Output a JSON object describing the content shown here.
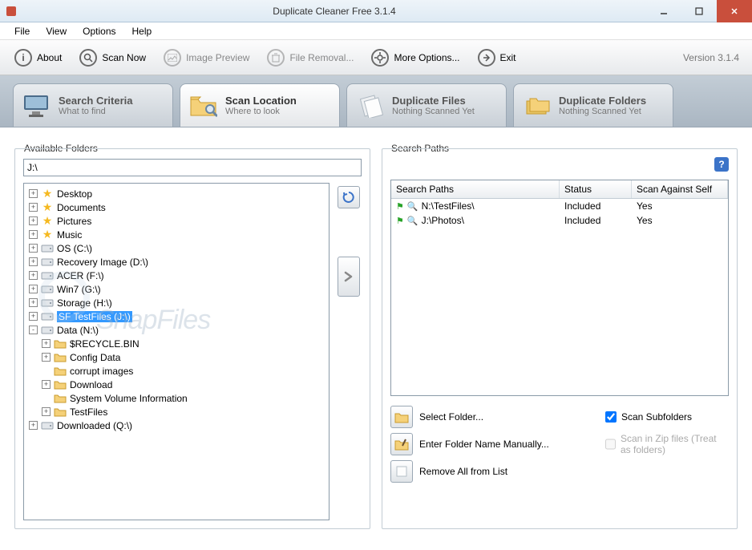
{
  "window": {
    "title": "Duplicate Cleaner Free 3.1.4"
  },
  "menu": {
    "file": "File",
    "view": "View",
    "options": "Options",
    "help": "Help"
  },
  "toolbar": {
    "about": "About",
    "scan_now": "Scan Now",
    "image_preview": "Image Preview",
    "file_removal": "File Removal...",
    "more_options": "More Options...",
    "exit": "Exit",
    "version": "Version 3.1.4"
  },
  "tabs": {
    "search_criteria": {
      "title": "Search Criteria",
      "sub": "What to find"
    },
    "scan_location": {
      "title": "Scan Location",
      "sub": "Where to look"
    },
    "duplicate_files": {
      "title": "Duplicate Files",
      "sub": "Nothing Scanned Yet"
    },
    "duplicate_folders": {
      "title": "Duplicate Folders",
      "sub": "Nothing Scanned Yet"
    }
  },
  "left_panel": {
    "title": "Available Folders",
    "path_value": "J:\\",
    "tree": [
      {
        "level": 0,
        "exp": "+",
        "icon": "star",
        "label": "Desktop"
      },
      {
        "level": 0,
        "exp": "+",
        "icon": "star",
        "label": "Documents"
      },
      {
        "level": 0,
        "exp": "+",
        "icon": "star",
        "label": "Pictures"
      },
      {
        "level": 0,
        "exp": "+",
        "icon": "star",
        "label": "Music"
      },
      {
        "level": 0,
        "exp": "+",
        "icon": "drive",
        "label": "OS (C:\\)"
      },
      {
        "level": 0,
        "exp": "+",
        "icon": "drive",
        "label": "Recovery Image (D:\\)"
      },
      {
        "level": 0,
        "exp": "+",
        "icon": "drive",
        "label": "ACER (F:\\)"
      },
      {
        "level": 0,
        "exp": "+",
        "icon": "drive",
        "label": "Win7 (G:\\)"
      },
      {
        "level": 0,
        "exp": "+",
        "icon": "drive",
        "label": "Storage (H:\\)"
      },
      {
        "level": 0,
        "exp": "+",
        "icon": "drive",
        "label": "SF TestFiles (J:\\)",
        "selected": true
      },
      {
        "level": 0,
        "exp": "-",
        "icon": "drive",
        "label": "Data (N:\\)"
      },
      {
        "level": 1,
        "exp": "+",
        "icon": "folder",
        "label": "$RECYCLE.BIN"
      },
      {
        "level": 1,
        "exp": "+",
        "icon": "folder",
        "label": "Config Data"
      },
      {
        "level": 1,
        "exp": "",
        "icon": "folder",
        "label": "corrupt images"
      },
      {
        "level": 1,
        "exp": "+",
        "icon": "folder",
        "label": "Download"
      },
      {
        "level": 1,
        "exp": "",
        "icon": "folder",
        "label": "System Volume Information"
      },
      {
        "level": 1,
        "exp": "+",
        "icon": "folder",
        "label": "TestFiles"
      },
      {
        "level": 0,
        "exp": "+",
        "icon": "drive",
        "label": "Downloaded (Q:\\)"
      }
    ]
  },
  "right_panel": {
    "title": "Search Paths",
    "headers": {
      "path": "Search Paths",
      "status": "Status",
      "self": "Scan Against Self"
    },
    "rows": [
      {
        "path": "N:\\TestFiles\\",
        "status": "Included",
        "self": "Yes"
      },
      {
        "path": "J:\\Photos\\",
        "status": "Included",
        "self": "Yes"
      }
    ],
    "actions": {
      "select_folder": "Select Folder...",
      "enter_manually": "Enter Folder Name Manually...",
      "remove_all": "Remove All from List",
      "scan_subfolders": "Scan Subfolders",
      "scan_in_zip": "Scan in Zip files (Treat as folders)"
    }
  },
  "watermark": "SnapFiles"
}
